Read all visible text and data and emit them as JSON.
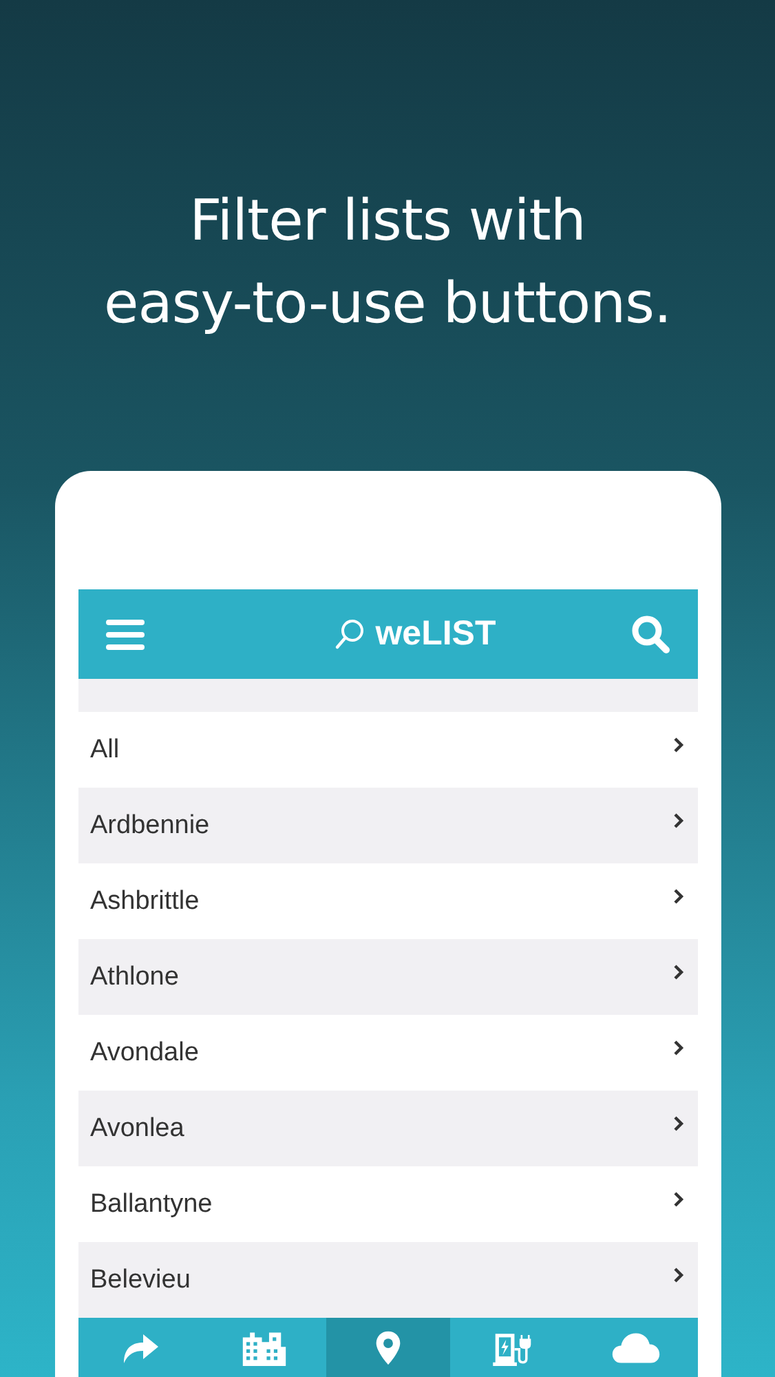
{
  "headline": [
    "Filter lists with",
    "easy-to-use buttons."
  ],
  "app_bar": {
    "title": "weLIST"
  },
  "list": [
    {
      "label": "All"
    },
    {
      "label": "Ardbennie"
    },
    {
      "label": "Ashbrittle"
    },
    {
      "label": "Athlone"
    },
    {
      "label": "Avondale"
    },
    {
      "label": "Avonlea"
    },
    {
      "label": "Ballantyne"
    },
    {
      "label": "Belevieu"
    }
  ],
  "bottom_tabs": [
    {
      "selected": false
    },
    {
      "selected": false
    },
    {
      "selected": true
    },
    {
      "selected": false
    },
    {
      "selected": false
    }
  ]
}
